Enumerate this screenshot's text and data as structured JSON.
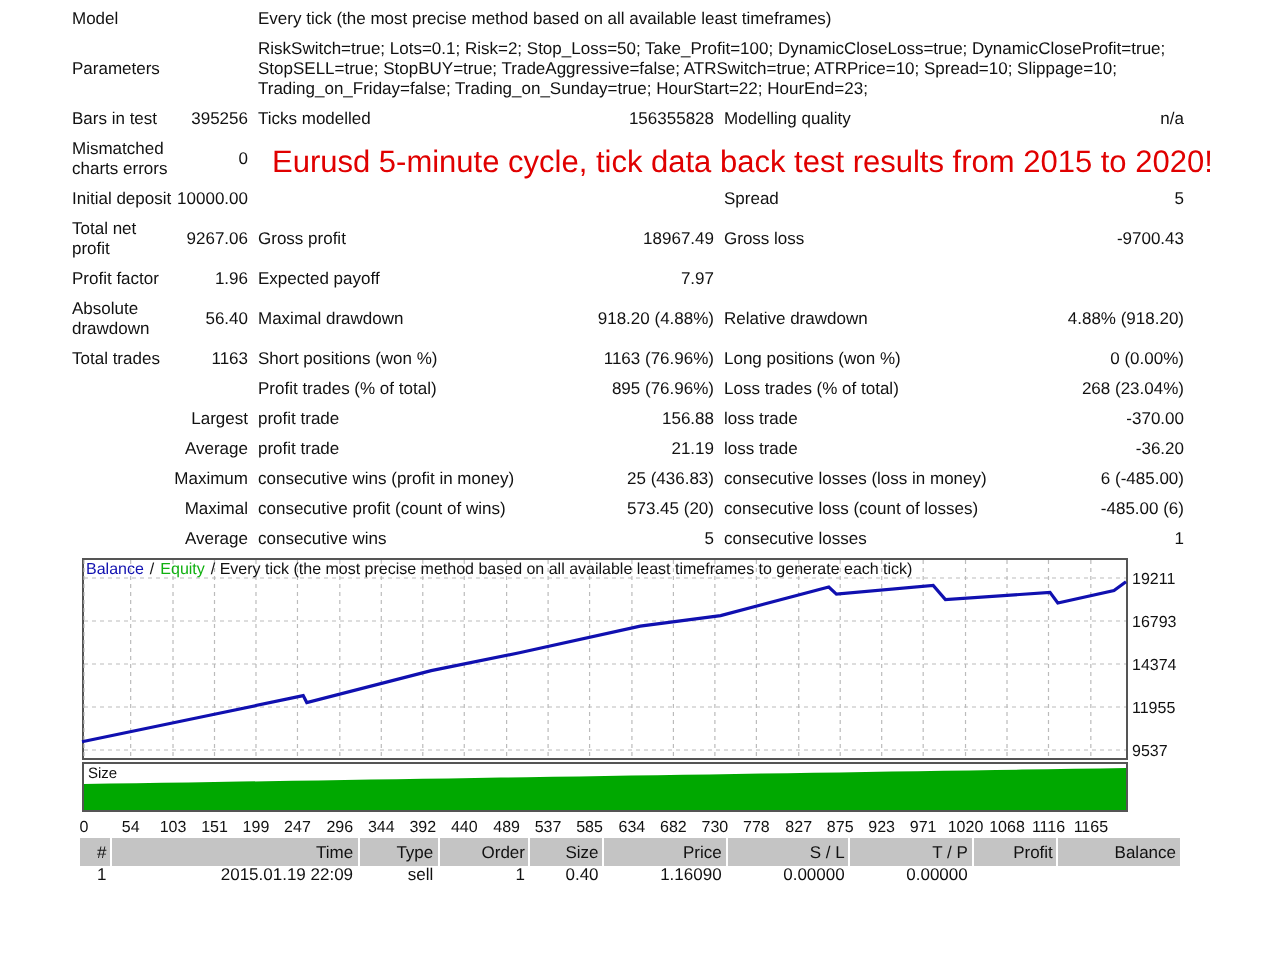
{
  "report": {
    "rows": [
      {
        "kind": "text",
        "label": "Model",
        "text": "Every tick (the most precise method based on all available least timeframes)"
      },
      {
        "kind": "text",
        "label": "Parameters",
        "text": "RiskSwitch=true; Lots=0.1; Risk=2; Stop_Loss=50; Take_Profit=100; DynamicCloseLoss=true; DynamicCloseProfit=true; StopSELL=true; StopBUY=true; TradeAggressive=false; ATRSwitch=true; ATRPrice=10; Spread=10; Slippage=10; Trading_on_Friday=false; Trading_on_Sunday=true; HourStart=22; HourEnd=23;"
      },
      {
        "kind": "stat",
        "label": "Bars in test",
        "value": "395256",
        "label_2": "Ticks modelled",
        "value_2": "156355828",
        "label_3": "Modelling quality",
        "value_3": "n/a"
      },
      {
        "kind": "stat",
        "label": "Mismatched charts errors",
        "value": "0",
        "note": "Eurusd 5-minute cycle, tick data back test results from 2015 to 2020!"
      },
      {
        "kind": "stat",
        "label": "Initial deposit",
        "value": "10000.00",
        "label_3": "Spread",
        "value_3": "5"
      },
      {
        "kind": "stat",
        "label": "Total net profit",
        "value": "9267.06",
        "label_2": "Gross profit",
        "value_2": "18967.49",
        "label_3": "Gross loss",
        "value_3": "-9700.43"
      },
      {
        "kind": "stat",
        "label": "Profit factor",
        "value": "1.96",
        "label_2": "Expected payoff",
        "value_2": "7.97"
      },
      {
        "kind": "stat",
        "label": "Absolute drawdown",
        "value": "56.40",
        "label_2": "Maximal drawdown",
        "value_2": "918.20 (4.88%)",
        "label_3": "Relative drawdown",
        "value_3": "4.88% (918.20)"
      },
      {
        "kind": "stat",
        "label": "Total trades",
        "value": "1163",
        "label_2": "Short positions (won %)",
        "value_2": "1163 (76.96%)",
        "label_3": "Long positions (won %)",
        "value_3": "0 (0.00%)"
      },
      {
        "kind": "sub",
        "label_2": "Profit trades (% of total)",
        "value_2": "895 (76.96%)",
        "label_3": "Loss trades (% of total)",
        "value_3": "268 (23.04%)"
      },
      {
        "kind": "sub",
        "label": "Largest",
        "label_2": "profit trade",
        "value_2": "156.88",
        "label_3": "loss trade",
        "value_3": "-370.00"
      },
      {
        "kind": "sub",
        "label": "Average",
        "label_2": "profit trade",
        "value_2": "21.19",
        "label_3": "loss trade",
        "value_3": "-36.20"
      },
      {
        "kind": "sub",
        "label": "Maximum",
        "label_2": "consecutive wins (profit in money)",
        "value_2": "25 (436.83)",
        "label_3": "consecutive losses (loss in money)",
        "value_3": "6 (-485.00)"
      },
      {
        "kind": "sub",
        "label": "Maximal",
        "label_2": "consecutive profit (count of wins)",
        "value_2": "573.45 (20)",
        "label_3": "consecutive loss (count of losses)",
        "value_3": "-485.00 (6)"
      },
      {
        "kind": "sub",
        "label": "Average",
        "label_2": "consecutive wins",
        "value_2": "5",
        "label_3": "consecutive losses",
        "value_3": "1"
      }
    ]
  },
  "balance_chart": {
    "separator": "/",
    "extra_legend": [
      {
        "text": "Equity",
        "color": "#10b010"
      }
    ],
    "chart_data": {
      "type": "line",
      "title": "Every tick (the most precise method based on all available least timeframes to generate each tick)",
      "x": [
        0,
        149,
        256,
        260,
        404,
        506,
        646,
        739,
        864,
        873,
        985,
        999,
        1120,
        1129,
        1194,
        1208
      ],
      "series": [
        {
          "name": "Balance",
          "color": "#1010b0",
          "values": [
            10000,
            11500,
            12600,
            12200,
            14000,
            15000,
            16500,
            17100,
            18700,
            18300,
            18800,
            18000,
            18400,
            17800,
            18500,
            19000
          ]
        }
      ],
      "xlim": [
        0,
        1208
      ],
      "ylim": [
        9087,
        20336
      ],
      "grid": true,
      "xticks": [
        0,
        54,
        103,
        151,
        199,
        247,
        296,
        344,
        392,
        440,
        489,
        537,
        585,
        634,
        682,
        730,
        778,
        827,
        875,
        923,
        971,
        1020,
        1068,
        1116,
        1165
      ],
      "yticks": [
        {
          "value": 9537,
          "label": "9537"
        },
        {
          "value": 11955,
          "label": "11955"
        },
        {
          "value": 14374,
          "label": "14374"
        },
        {
          "value": 16793,
          "label": "16793"
        },
        {
          "value": 19211,
          "label": "19211"
        }
      ]
    }
  },
  "size_chart": {
    "label": "Size"
  },
  "trades_table": {
    "columns": [
      "#",
      "Time",
      "Type",
      "Order",
      "Size",
      "Price",
      "S / L",
      "T / P",
      "Profit",
      "Balance"
    ],
    "rows": [
      [
        "1",
        "2015.01.19 22:09",
        "sell",
        "1",
        "0.40",
        "1.16090",
        "0.00000",
        "0.00000"
      ]
    ]
  }
}
